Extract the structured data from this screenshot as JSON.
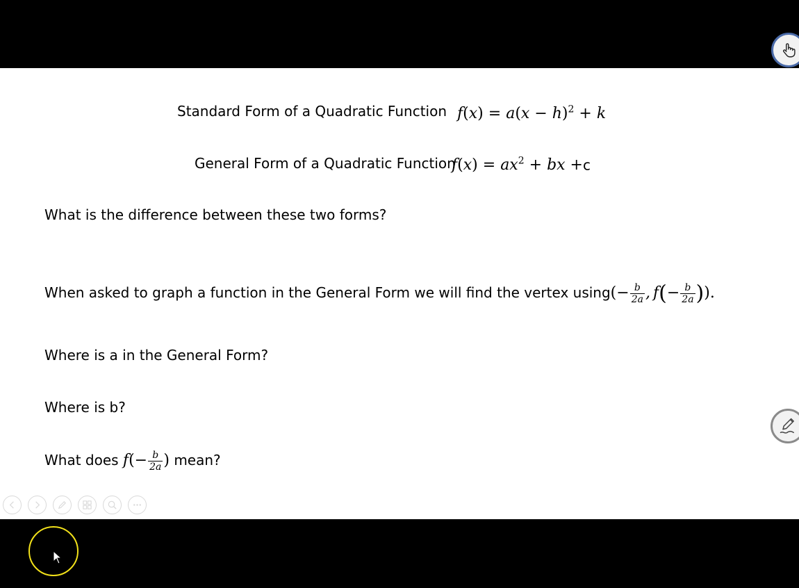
{
  "slide": {
    "standard_form": {
      "label": "Standard Form of a Quadratic Function",
      "formula": "f(x) = a(x − h)² + k"
    },
    "general_form": {
      "label": "General Form of a Quadratic Function",
      "formula": "f(x) = ax² + bx +c"
    },
    "question_difference": "What is the difference between these two forms?",
    "vertex_statement": {
      "text": "When asked to graph a function in the General Form we will find the vertex using",
      "numerator": "b",
      "denominator": "2a"
    },
    "question_a": "Where is a in the General Form?",
    "question_b": "Where is b?",
    "question_meaning": {
      "prefix": "What does",
      "suffix": "mean?"
    }
  },
  "toolbar": {
    "icons": [
      "previous-icon",
      "next-icon",
      "pen-icon",
      "slides-icon",
      "zoom-icon",
      "more-icon"
    ]
  },
  "float_buttons": [
    "hand-pointer-icon",
    "pen-ink-icon"
  ],
  "colors": {
    "background": "#000000",
    "slide": "#ffffff",
    "cursor_highlight": "#f3e21a",
    "hand_button_border": "#4a6aa8"
  }
}
